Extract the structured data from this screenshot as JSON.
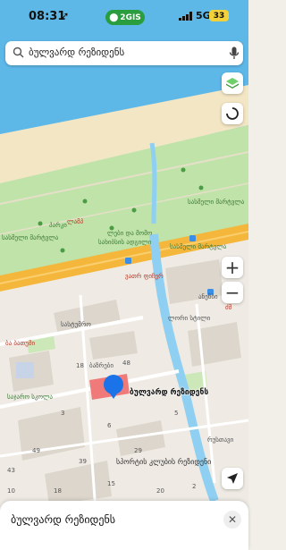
{
  "status": {
    "time": "08:31",
    "brand_badge": "2GIS",
    "network": "5G",
    "battery": "33"
  },
  "search": {
    "query": "ბულვარდ რეზიდენს"
  },
  "map_controls": {
    "zoom_in": "+",
    "zoom_out": "−"
  },
  "map_labels": {
    "park": "პარკი",
    "sas_mrt_1": "სასმელი მარტვლა",
    "sas_mrt_2": "სასმელი მარტვლა",
    "sas_mrt_3": "სასმელი მარტვლა",
    "lamp": "ლამპ",
    "lebi_momo": "ლები და მომო",
    "sakhibs": "სახიბსის ადგილი",
    "pharmacy": "ვათრ ფიჩერ",
    "ashenebi": "ანენბი",
    "sastumro": "სასტუმრო",
    "lori_stile": "ლორი სტილი",
    "bazari": "ბაზრები",
    "ba_tsc": "ბა ბათუმი",
    "pub_school": "საჯარო სკოლა",
    "rustavi": "რუსთავი",
    "num_49": "49",
    "num_18": "18",
    "num_48": "48",
    "num_5": "5",
    "num_3": "3",
    "num_43": "43",
    "num_39": "39",
    "num_29": "29",
    "num_6": "6",
    "num_15": "15",
    "num_20": "20",
    "num_10": "10",
    "num_2": "2",
    "num_18b": "18",
    "sports_club": "სპორტის კლუბის რეზიდენი",
    "dzmebi": "ძმ"
  },
  "pin": {
    "label": "ბულვარდ რეზიდენს"
  },
  "sheet": {
    "title": "ბულვარდ რეზიდენს",
    "close": "✕"
  }
}
